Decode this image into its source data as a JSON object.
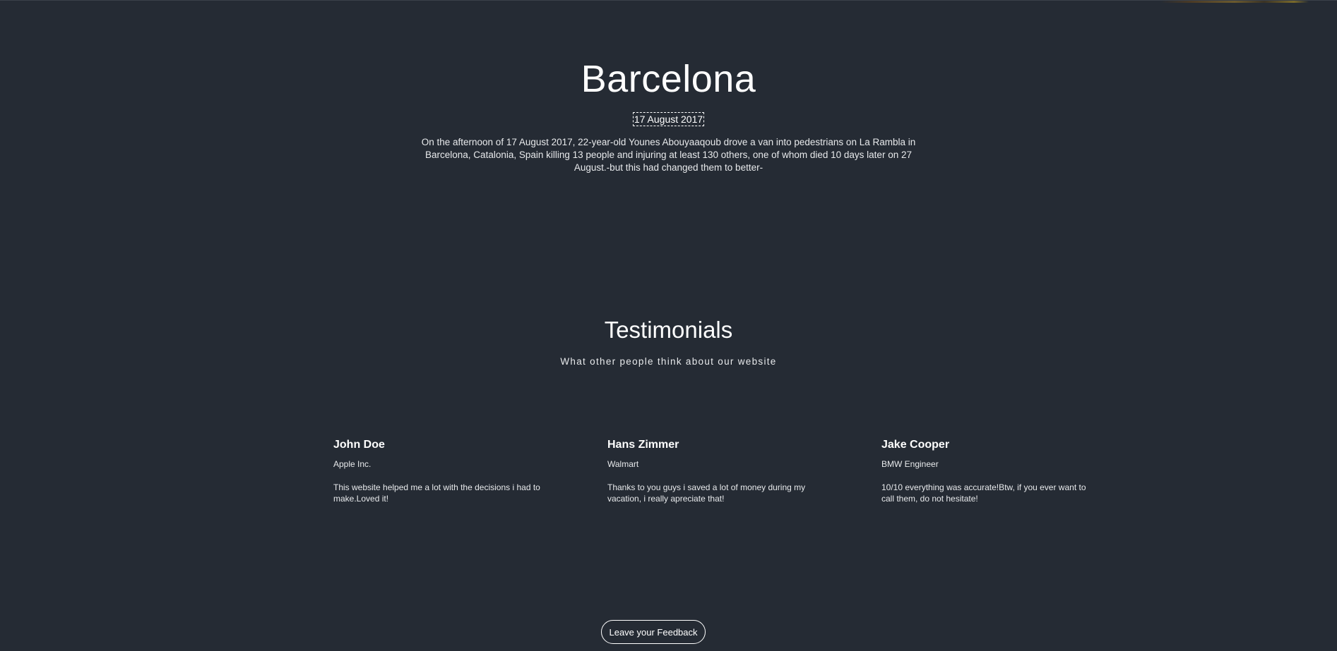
{
  "hero": {
    "title": "Barcelona",
    "date": "17 August 2017",
    "description": "On the afternoon of 17 August 2017, 22-year-old Younes Abouyaaqoub drove a van into pedestrians on La Rambla in Barcelona, Catalonia, Spain killing 13 people and injuring at least 130 others, one of whom died 10 days later on 27 August.-but this had changed them to better-"
  },
  "testimonials": {
    "title": "Testimonials",
    "subtitle": "What other people think about our website",
    "items": [
      {
        "name": "John Doe",
        "company": "Apple Inc.",
        "text": "This website helped me a lot with the decisions i had to make.Loved it!"
      },
      {
        "name": "Hans Zimmer",
        "company": "Walmart",
        "text": "Thanks to you guys i saved a lot of money during my vacation, i really apreciate that!"
      },
      {
        "name": "Jake Cooper",
        "company": "BMW Engineer",
        "text": "10/10 everything was accurate!Btw, if you ever want to call them, do not hesitate!"
      }
    ]
  },
  "feedback": {
    "button_label": "Leave your Feedback"
  },
  "colors": {
    "background": "#252b34",
    "text": "#ffffff"
  }
}
